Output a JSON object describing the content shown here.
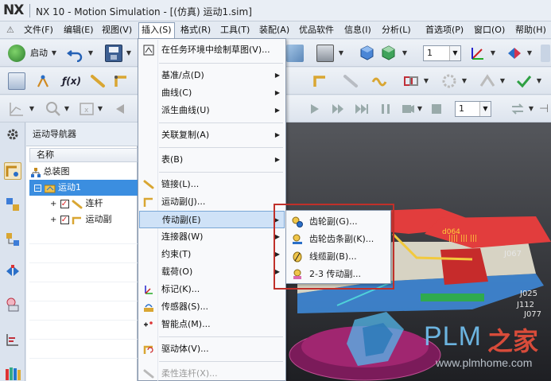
{
  "window": {
    "logo": "NX",
    "title": "NX 10 - Motion Simulation - [(仿真) 运动1.sim]"
  },
  "menubar": {
    "items": [
      "文件(F)",
      "编辑(E)",
      "视图(V)",
      "插入(S)",
      "格式(R)",
      "工具(T)",
      "装配(A)",
      "优品软件",
      "信息(I)",
      "分析(L)",
      "首选项(P)",
      "窗口(O)",
      "帮助(H)"
    ],
    "active": "插入(S)"
  },
  "toolbar1": {
    "start_label": "启动",
    "select_value_1": "1"
  },
  "toolbar3": {
    "select_value": "1"
  },
  "navigator": {
    "title": "运动导航器",
    "column_header": "名称",
    "tree": [
      {
        "label": "总装图",
        "level": 0
      },
      {
        "label": "运动1",
        "level": 1,
        "selected": true
      },
      {
        "label": "连杆",
        "level": 2,
        "checked": true
      },
      {
        "label": "运动副",
        "level": 2,
        "checked": true
      }
    ]
  },
  "insert_menu": {
    "items": [
      {
        "label": "在任务环境中绘制草图(V)...",
        "icon": "sketch-icon",
        "submenu": false
      },
      {
        "label": "基准/点(D)",
        "submenu": true
      },
      {
        "label": "曲线(C)",
        "submenu": true
      },
      {
        "label": "派生曲线(U)",
        "submenu": true
      },
      {
        "label": "关联复制(A)",
        "submenu": true
      },
      {
        "label": "表(B)",
        "submenu": true
      },
      {
        "label": "链接(L)...",
        "icon": "link-icon",
        "submenu": false
      },
      {
        "label": "运动副(J)...",
        "icon": "joint-icon",
        "submenu": false
      },
      {
        "label": "传动副(E)",
        "submenu": true,
        "highlighted": true
      },
      {
        "label": "连接器(W)",
        "submenu": true
      },
      {
        "label": "约束(T)",
        "submenu": true
      },
      {
        "label": "载荷(O)",
        "submenu": true
      },
      {
        "label": "标记(K)...",
        "icon": "marker-icon",
        "submenu": false
      },
      {
        "label": "传感器(S)...",
        "icon": "sensor-icon",
        "submenu": false
      },
      {
        "label": "智能点(M)...",
        "icon": "smart-point-icon",
        "submenu": false
      },
      {
        "label": "驱动体(V)...",
        "icon": "driver-icon",
        "submenu": false
      },
      {
        "label": "柔性连杆(X)...",
        "icon": "flex-link-icon",
        "submenu": false,
        "disabled": true
      }
    ]
  },
  "sub_menu": {
    "items": [
      {
        "label": "齿轮副(G)...",
        "icon": "gear-pair-icon"
      },
      {
        "label": "齿轮齿条副(K)...",
        "icon": "rack-pinion-icon"
      },
      {
        "label": "线缆副(B)...",
        "icon": "cable-icon"
      },
      {
        "label": "2-3 传动副...",
        "icon": "coupler-icon"
      }
    ]
  },
  "watermark": {
    "brand": "PLM",
    "brand_cn": "之家",
    "url": "www.plmhome.com"
  },
  "colors": {
    "accent": "#3b8ee0",
    "highlight_box": "#c0302a",
    "menu_highlight": "#cfe2f7"
  }
}
